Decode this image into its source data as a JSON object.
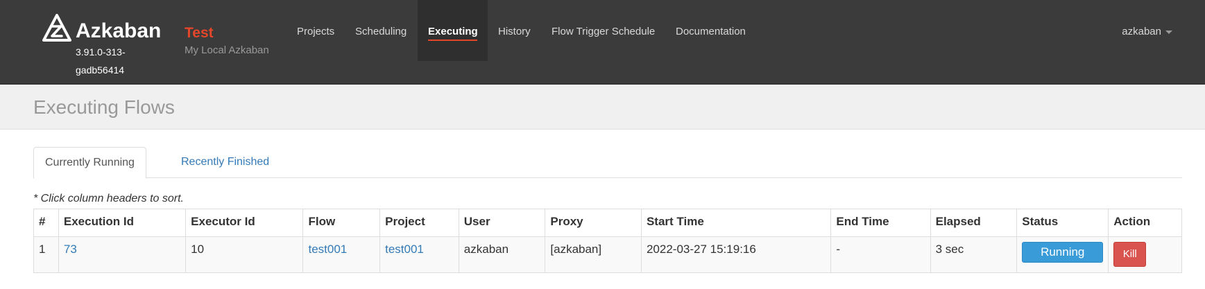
{
  "app": {
    "name": "Azkaban",
    "version": "3.91.0-313-gadb56414",
    "env_name": "Test",
    "env_description": "My Local Azkaban"
  },
  "nav": {
    "items": [
      {
        "label": "Projects"
      },
      {
        "label": "Scheduling"
      },
      {
        "label": "Executing"
      },
      {
        "label": "History"
      },
      {
        "label": "Flow Trigger Schedule"
      },
      {
        "label": "Documentation"
      }
    ],
    "active": "Executing"
  },
  "user": {
    "name": "azkaban"
  },
  "page": {
    "title": "Executing Flows"
  },
  "tabs": [
    {
      "label": "Currently Running"
    },
    {
      "label": "Recently Finished"
    }
  ],
  "hint": "* Click column headers to sort.",
  "table": {
    "headers": [
      "#",
      "Execution Id",
      "Executor Id",
      "Flow",
      "Project",
      "User",
      "Proxy",
      "Start Time",
      "End Time",
      "Elapsed",
      "Status",
      "Action"
    ],
    "rows": [
      {
        "index": "1",
        "execution_id": "73",
        "executor_id": "10",
        "flow": "test001",
        "project": "test001",
        "user": "azkaban",
        "proxy": "[azkaban]",
        "start_time": "2022-03-27 15:19:16",
        "end_time": "-",
        "elapsed": "3 sec",
        "status": "Running",
        "action": "Kill"
      }
    ]
  },
  "colors": {
    "navbar": "#3b3b3b",
    "accent": "#e4462a",
    "link": "#337ab7",
    "running": "#3a9bd9",
    "kill": "#d9534f"
  },
  "icons": {
    "logo": "azkaban-logo-icon",
    "user_caret": "caret-down-icon"
  }
}
